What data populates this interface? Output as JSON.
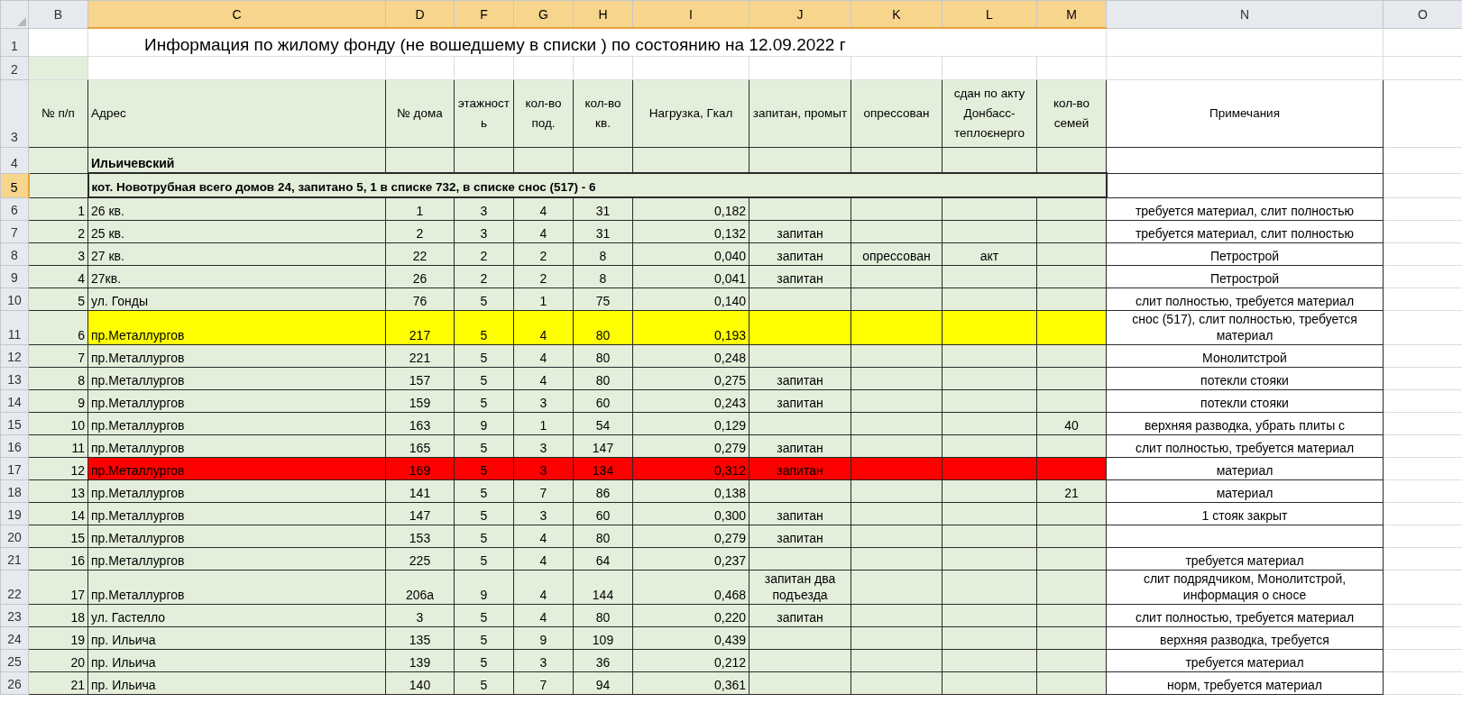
{
  "column_headers": [
    {
      "label": "B",
      "selected": false
    },
    {
      "label": "C",
      "selected": true
    },
    {
      "label": "D",
      "selected": true
    },
    {
      "label": "F",
      "selected": true
    },
    {
      "label": "G",
      "selected": true
    },
    {
      "label": "H",
      "selected": true
    },
    {
      "label": "I",
      "selected": true
    },
    {
      "label": "J",
      "selected": true
    },
    {
      "label": "K",
      "selected": true
    },
    {
      "label": "L",
      "selected": true
    },
    {
      "label": "M",
      "selected": true
    },
    {
      "label": "N",
      "selected": false
    },
    {
      "label": "O",
      "selected": false
    }
  ],
  "rows": [
    {
      "number": "1",
      "selected": false,
      "kind": "title",
      "text": "Информация по жилому фонду (не вошедшему в списки ) по состоянию на 12.09.2022 г"
    },
    {
      "number": "2",
      "selected": false,
      "kind": "blank"
    },
    {
      "number": "3",
      "selected": false,
      "kind": "header",
      "cells": [
        "№ п/п",
        "Адрес",
        "№ дома",
        "этажность",
        "кол-во под.",
        "кол-во кв.",
        "Нагрузка, Гкал",
        "запитан, промыт",
        "опрессован",
        "сдан по акту Донбасс-теплоєнерго",
        "кол-во семей",
        "Примечания"
      ]
    },
    {
      "number": "4",
      "selected": false,
      "kind": "section",
      "text": "Ильичевский"
    },
    {
      "number": "5",
      "selected": true,
      "kind": "group",
      "text": "кот. Новотрубная  всего домов 24, запитано 5, 1 в списке 732, в списке снос (517) - 6"
    },
    {
      "number": "6",
      "selected": false,
      "kind": "data",
      "cells": [
        "1",
        "26 кв.",
        "1",
        "3",
        "4",
        "31",
        "0,182",
        "",
        "",
        "",
        "",
        "требуется материал, слит полностью"
      ]
    },
    {
      "number": "7",
      "selected": false,
      "kind": "data",
      "cells": [
        "2",
        "25 кв.",
        "2",
        "3",
        "4",
        "31",
        "0,132",
        "запитан",
        "",
        "",
        "",
        "требуется материал, слит полностью"
      ]
    },
    {
      "number": "8",
      "selected": false,
      "kind": "data",
      "cells": [
        "3",
        "27 кв.",
        "22",
        "2",
        "2",
        "8",
        "0,040",
        "запитан",
        "опрессован",
        "акт",
        "",
        "Петрострой"
      ]
    },
    {
      "number": "9",
      "selected": false,
      "kind": "data",
      "cells": [
        "4",
        "27кв.",
        "26",
        "2",
        "2",
        "8",
        "0,041",
        "запитан",
        "",
        "",
        "",
        "Петрострой"
      ]
    },
    {
      "number": "10",
      "selected": false,
      "kind": "data",
      "cells": [
        "5",
        " ул. Гонды",
        "76",
        "5",
        "1",
        "75",
        "0,140",
        "",
        "",
        "",
        "",
        "слит полностью, требуется материал"
      ]
    },
    {
      "number": "11",
      "selected": false,
      "kind": "data",
      "color": "#ffff00",
      "cells": [
        "6",
        "пр.Металлургов",
        "217",
        "5",
        "4",
        "80",
        "0,193",
        "",
        "",
        "",
        "",
        "снос (517), слит полностью, требуется материал"
      ]
    },
    {
      "number": "12",
      "selected": false,
      "kind": "data",
      "cells": [
        "7",
        "пр.Металлургов",
        "221",
        "5",
        "4",
        "80",
        "0,248",
        "",
        "",
        "",
        "",
        "Монолитстрой"
      ]
    },
    {
      "number": "13",
      "selected": false,
      "kind": "data",
      "cells": [
        "8",
        "пр.Металлургов",
        "157",
        "5",
        "4",
        "80",
        "0,275",
        "запитан",
        "",
        "",
        "",
        "потекли стояки"
      ]
    },
    {
      "number": "14",
      "selected": false,
      "kind": "data",
      "cells": [
        "9",
        "пр.Металлургов",
        "159",
        "5",
        "3",
        "60",
        "0,243",
        "запитан",
        "",
        "",
        "",
        "потекли стояки"
      ]
    },
    {
      "number": "15",
      "selected": false,
      "kind": "data",
      "cells": [
        "10",
        "пр.Металлургов",
        "163",
        "9",
        "1",
        "54",
        "0,129",
        "",
        "",
        "",
        "40",
        "верхняя разводка, убрать плиты с"
      ]
    },
    {
      "number": "16",
      "selected": false,
      "kind": "data",
      "cells": [
        "11",
        "пр.Металлургов",
        "165",
        "5",
        "3",
        "147",
        "0,279",
        "запитан",
        "",
        "",
        "",
        "слит полностью, требуется материал"
      ]
    },
    {
      "number": "17",
      "selected": false,
      "kind": "data",
      "color": "#ff0000",
      "cells": [
        "12",
        "пр.Металлургов",
        "169",
        "5",
        "3",
        "134",
        "0,312",
        "запитан",
        "",
        "",
        "",
        "материал"
      ]
    },
    {
      "number": "18",
      "selected": false,
      "kind": "data",
      "cells": [
        "13",
        "пр.Металлургов",
        "141",
        "5",
        "7",
        "86",
        "0,138",
        "",
        "",
        "",
        "21",
        "материал"
      ]
    },
    {
      "number": "19",
      "selected": false,
      "kind": "data",
      "cells": [
        "14",
        "пр.Металлургов",
        "147",
        "5",
        "3",
        "60",
        "0,300",
        "запитан",
        "",
        "",
        "",
        "1 стояк закрыт"
      ]
    },
    {
      "number": "20",
      "selected": false,
      "kind": "data",
      "cells": [
        "15",
        "пр.Металлургов",
        "153",
        "5",
        "4",
        "80",
        "0,279",
        "запитан",
        "",
        "",
        "",
        ""
      ]
    },
    {
      "number": "21",
      "selected": false,
      "kind": "data",
      "cells": [
        "16",
        "пр.Металлургов",
        "225",
        "5",
        "4",
        "64",
        "0,237",
        "",
        "",
        "",
        "",
        "требуется материал"
      ]
    },
    {
      "number": "22",
      "selected": false,
      "kind": "data",
      "cells": [
        "17",
        "пр.Металлургов",
        "206а",
        "9",
        "4",
        "144",
        "0,468",
        "запитан два подъезда",
        "",
        "",
        "",
        "слит подрядчиком, Монолитстрой, информация о сносе"
      ]
    },
    {
      "number": "23",
      "selected": false,
      "kind": "data",
      "cells": [
        "18",
        "ул. Гастелло",
        "3",
        "5",
        "4",
        "80",
        "0,220",
        "запитан",
        "",
        "",
        "",
        "слит полностью, требуется материал"
      ]
    },
    {
      "number": "24",
      "selected": false,
      "kind": "data",
      "cells": [
        "19",
        "пр. Ильича",
        "135",
        "5",
        "9",
        "109",
        "0,439",
        "",
        "",
        "",
        "",
        "верхняя разводка, требуется"
      ]
    },
    {
      "number": "25",
      "selected": false,
      "kind": "data",
      "cells": [
        "20",
        "пр. Ильича",
        "139",
        "5",
        "3",
        "36",
        "0,212",
        "",
        "",
        "",
        "",
        "требуется материал"
      ]
    },
    {
      "number": "26",
      "selected": false,
      "kind": "data",
      "cells": [
        "21",
        "пр. Ильича",
        "140",
        "5",
        "7",
        "94",
        "0,361",
        "",
        "",
        "",
        "",
        "норм, требуется материал"
      ]
    }
  ]
}
